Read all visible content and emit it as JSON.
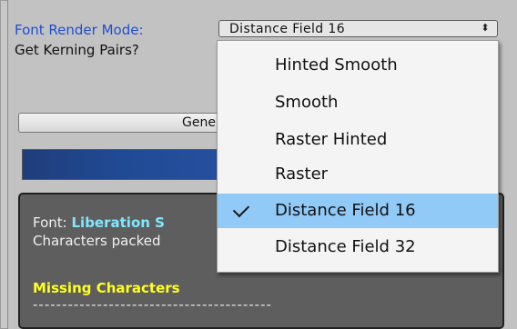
{
  "labels": {
    "font_render_mode": "Font Render Mode:",
    "get_kerning": "Get Kerning Pairs?"
  },
  "render_mode_select": {
    "value": "Distance Field 16",
    "arrows": "⬍"
  },
  "generate_button": {
    "label": "Gene"
  },
  "info": {
    "font_label": "Font:",
    "font_value": "Liberation S",
    "characters_text": "Characters packed",
    "missing_title": "Missing Characters",
    "dashes": "-----------------------------------------"
  },
  "dropdown": {
    "options": [
      {
        "label": "Hinted Smooth"
      },
      {
        "label": "Smooth"
      },
      {
        "label": "Raster Hinted"
      },
      {
        "label": "Raster"
      },
      {
        "label": "Distance Field 16"
      },
      {
        "label": "Distance Field 32"
      }
    ],
    "selected_index": 4,
    "selected_color": "#91c9f7"
  },
  "colors": {
    "label_blue": "#1f4fd1",
    "progress_blue": "#214a95",
    "font_value": "#7fe8ff",
    "missing_title": "#ffff22"
  }
}
